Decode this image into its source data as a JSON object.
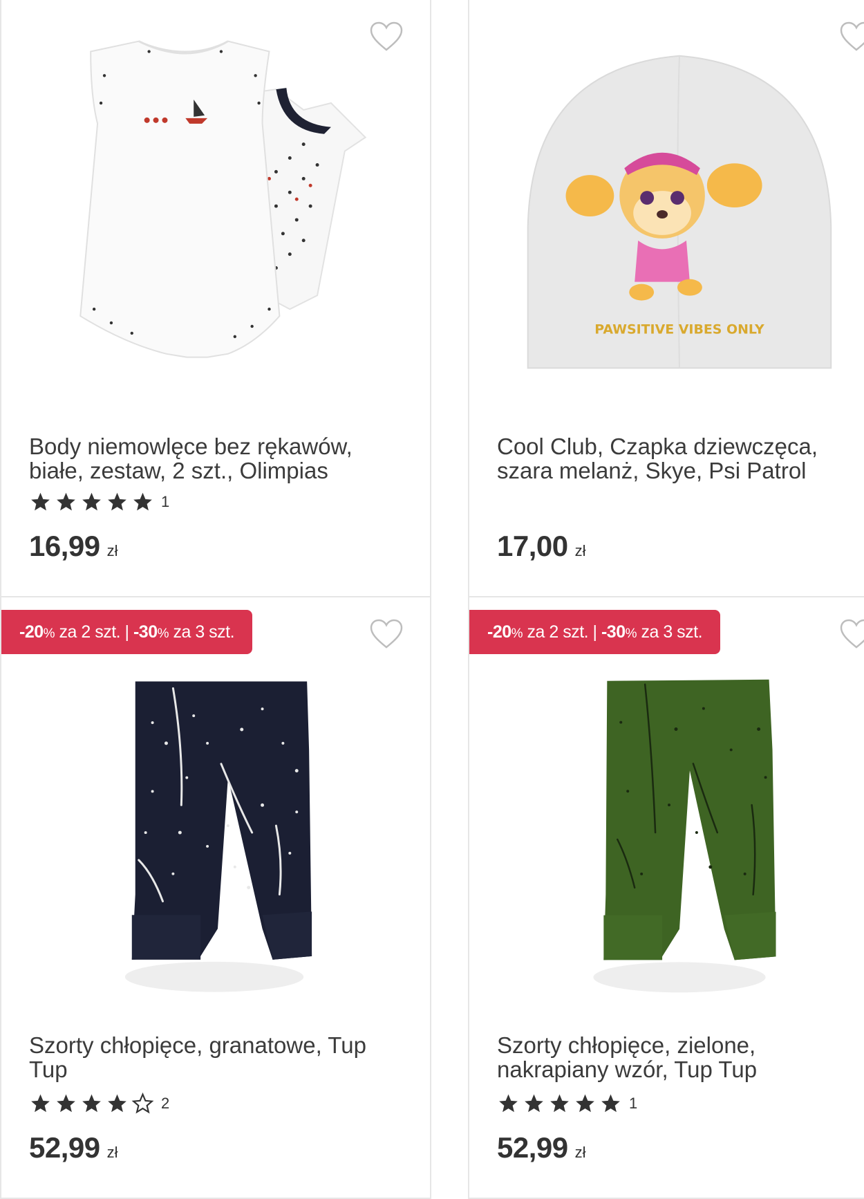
{
  "products": [
    {
      "title": "Body niemowlęce bez rękawów, białe, zestaw, 2 szt., Olimpias",
      "rating_stars": 5,
      "rating_count": "1",
      "price": "16,99",
      "currency": "zł",
      "favorite_icon": "heart-outline-icon"
    },
    {
      "title": "Cool Club, Czapka dziewczęca, szara melanż, Skye, Psi Patrol",
      "price": "17,00",
      "currency": "zł",
      "favorite_icon": "heart-outline-icon",
      "image_print_text": "PAWSITIVE VIBES ONLY"
    },
    {
      "promo": {
        "p1": "-20",
        "pct1": "%",
        "t1": " za 2 szt. | ",
        "p2": "-30",
        "pct2": "%",
        "t2": " za 3 szt."
      },
      "title": "Szorty chłopięce, granatowe, Tup Tup",
      "rating_stars": 4,
      "rating_count": "2",
      "price": "52,99",
      "currency": "zł",
      "favorite_icon": "heart-outline-icon"
    },
    {
      "promo": {
        "p1": "-20",
        "pct1": "%",
        "t1": " za 2 szt. | ",
        "p2": "-30",
        "pct2": "%",
        "t2": " za 3 szt."
      },
      "title": "Szorty chłopięce, zielone, nakrapiany wzór, Tup Tup",
      "rating_stars": 5,
      "rating_count": "1",
      "price": "52,99",
      "currency": "zł",
      "favorite_icon": "heart-outline-icon"
    }
  ],
  "colors": {
    "promo_badge": "#d9344f",
    "text": "#333333",
    "border": "#e6e6e6",
    "star": "#333333"
  }
}
